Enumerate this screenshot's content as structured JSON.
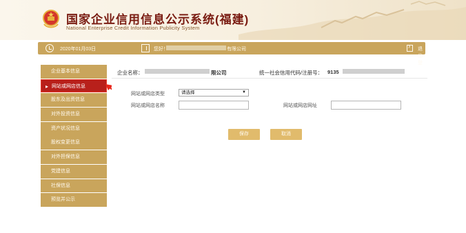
{
  "header": {
    "title": "国家企业信用信息公示系统",
    "region": "(福建)",
    "subtitle": "National Enterprise Credit Information Publicity System",
    "emblem_icon": "national-emblem-icon"
  },
  "infobar": {
    "date": "2020年01月03日",
    "greeting": "您好！",
    "company_suffix": "有限公司",
    "logout_label": "退出登录",
    "icons": [
      "clock-icon",
      "user-card-icon",
      "logout-icon"
    ]
  },
  "sidebar": {
    "items": [
      {
        "label": "企业基本信息"
      },
      {
        "label": "网站或网店信息"
      },
      {
        "label": "股东及出资信息"
      },
      {
        "label": "对外投资信息"
      },
      {
        "label": "资产状况信息"
      },
      {
        "label": "股权变更信息"
      },
      {
        "label": "对外担保信息"
      },
      {
        "label": "党建信息"
      },
      {
        "label": "社保信息"
      },
      {
        "label": "预览并公示"
      }
    ],
    "active_label": "网站或网店信息"
  },
  "company": {
    "name_label": "企业名称：",
    "name_suffix": "限公司",
    "code_label": "统一社会信用代码/注册号：",
    "code_prefix": "9135"
  },
  "form": {
    "type_label": "网站或网店类型",
    "type_selected": "请选择",
    "name_label": "网站或网店名称",
    "name_value": "",
    "url_label": "网站或网店网址",
    "url_value": ""
  },
  "buttons": {
    "save_label": "保存",
    "cancel_label": "取消"
  },
  "colors": {
    "gold": "#c9a55c",
    "button_gold": "#e1bb6c",
    "active_red": "#b8201b",
    "title_red": "#7a1c12"
  }
}
